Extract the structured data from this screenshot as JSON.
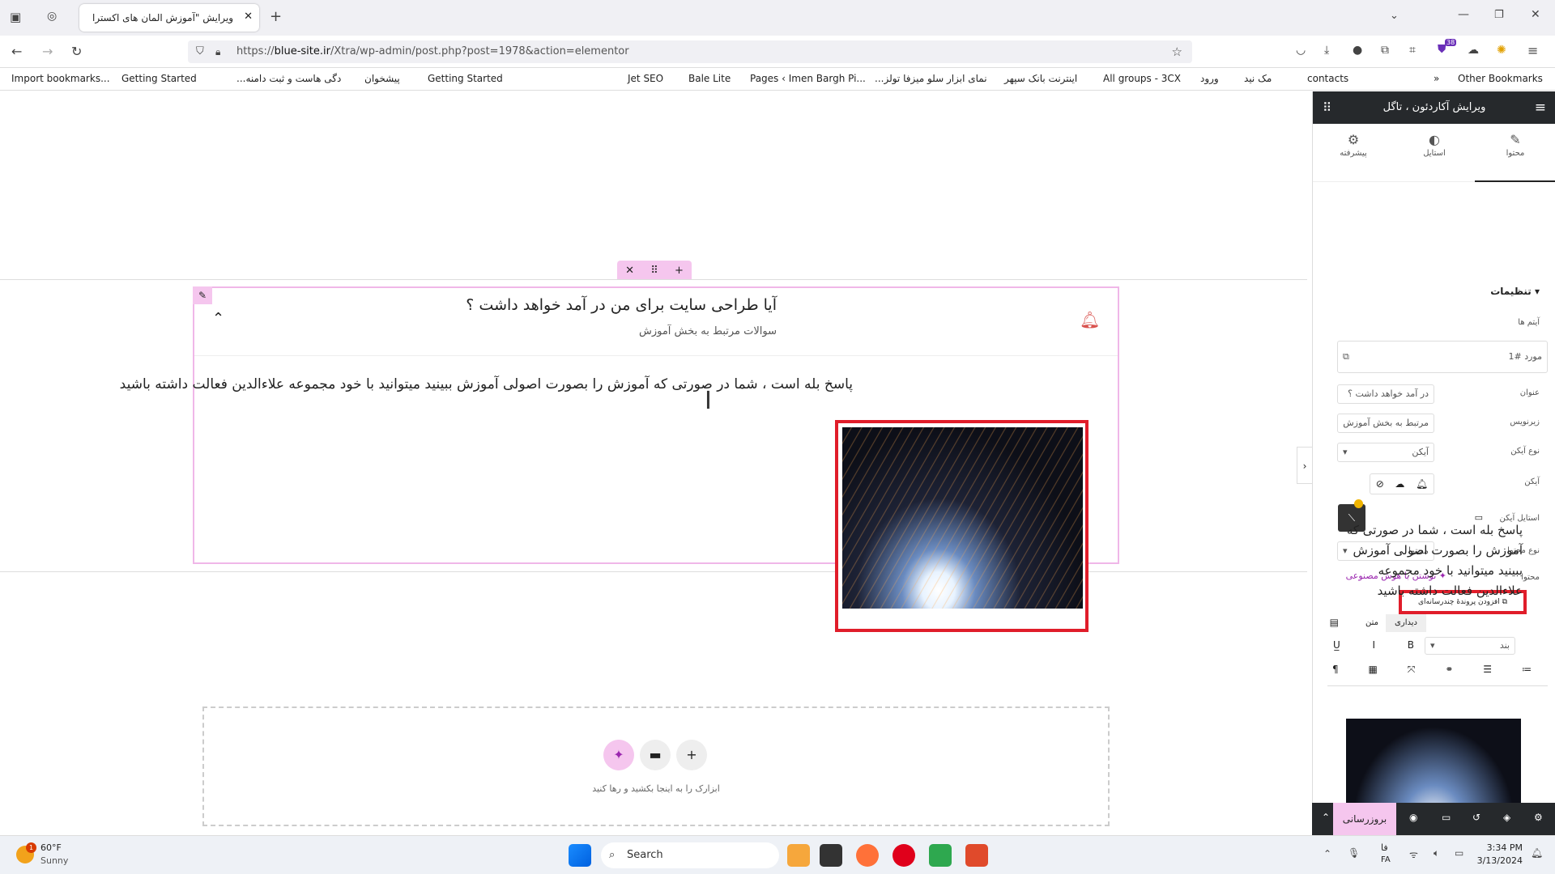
{
  "browser": {
    "tab_title": "ویرایش \"آموزش المان های اکسترا",
    "url_prefix": "https://",
    "url_domain": "blue-site.ir",
    "url_path": "/Xtra/wp-admin/post.php?post=1978&action=elementor",
    "extension_badge": "38",
    "bookmarks": [
      "Import bookmarks...",
      "Getting Started",
      "...دگی هاست و ثبت دامنه",
      "پیشخوان",
      "Getting Started",
      "Jet SEO",
      "Bale Lite",
      "Pages ‹ Imen Bargh Pi...",
      "...نمای ابزار سلو میزفا تولز",
      "اینترنت بانک سپهر",
      "All groups - 3CX",
      "ورود",
      "مک نید",
      "contacts",
      "Other Bookmarks"
    ]
  },
  "canvas": {
    "accordion_title": "آیا طراحی سایت برای من در آمد خواهد داشت ؟",
    "accordion_subtitle": "سوالات مرتبط به بخش آموزش",
    "answer": "پاسخ بله است ، شما در صورتی که آموزش را بصورت اصولی آموزش ببینید میتوانید با خود مجموعه علاءالدین فعالت داشته باشید",
    "dropzone_text": "ابزارک را به اینجا بکشید و رها کنید"
  },
  "panel": {
    "title": "ویرایش آکاردئون ، تاگل",
    "tabs": [
      "محتوا",
      "استایل",
      "پیشرفته"
    ],
    "section": "تنظیمات",
    "items_label": "آیتم ها",
    "item_name": "مورد #1",
    "title_label": "عنوان",
    "title_value": "در آمد خواهد داشت ؟",
    "subtitle_label": "زیرنویس",
    "subtitle_value": "مرتبط به بخش آموزش",
    "icon_type_label": "نوع آیکن",
    "icon_type_value": "آیکن",
    "icon_label": "آیکن",
    "icon_style_label": "استایل آیکن",
    "content_type_label": "نوع محتوا",
    "content_type_value": "محتوا",
    "content_label": "محتوا",
    "ai_write": "نوشتن با هوش مصنوعی",
    "add_media": "افزودن پروندهٔ چندرسانه‌ای",
    "editor_tab_visual": "دیداری",
    "editor_tab_text": "متن",
    "format_value": "بند",
    "editor_text": "پاسخ بله است ، شما در صورتی که آموزش را بصورت اصولی آموزش ببینید میتوانید با خود مجموعه علاءالدین فعالت داشته باشید",
    "update_button": "بروزرسانی"
  },
  "taskbar": {
    "weather_temp": "60°F",
    "weather_cond": "Sunny",
    "weather_badge": "1",
    "search": "Search",
    "lang_top": "فا",
    "lang_bottom": "FA",
    "time": "3:34 PM",
    "date": "3/13/2024"
  },
  "colors": {
    "accent": "#f5c6ee",
    "highlight_red": "#e01d2a",
    "panel_dark": "#26292c",
    "ai_purple": "#9b27af"
  }
}
